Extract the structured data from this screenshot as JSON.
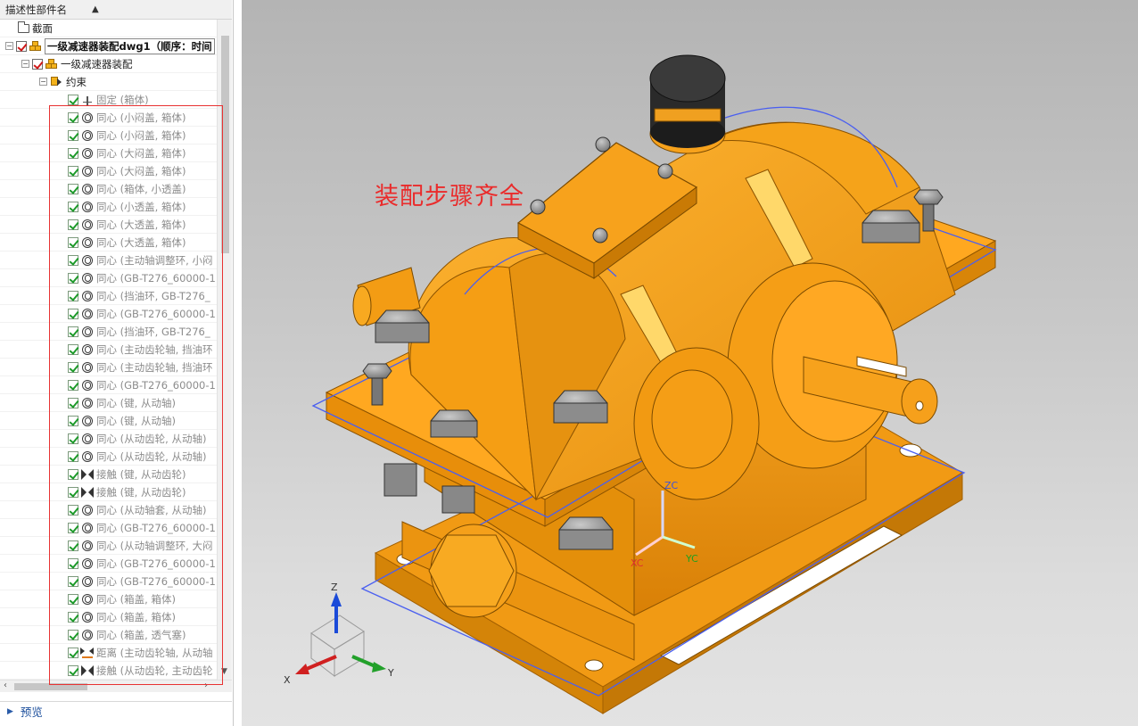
{
  "navigator": {
    "column_header": "描述性部件名",
    "sort_icon": "sort-ascending-icon",
    "rows": [
      {
        "label": "截面",
        "icon": "folder-icon",
        "checkbox": false
      },
      {
        "label": "一级减速器装配dwg1（顺序：时间",
        "icon": "assembly-icon",
        "checkbox": true
      },
      {
        "label": "一级减速器装配",
        "icon": "assembly-icon",
        "checkbox": true
      },
      {
        "label": "约束",
        "icon": "constraints-icon",
        "checkbox": false
      },
      {
        "label": "固定 (箱体)",
        "icon": "fix-icon"
      },
      {
        "label": "同心 (小闷盖, 箱体)",
        "icon": "concentric-icon"
      },
      {
        "label": "同心 (小闷盖, 箱体)",
        "icon": "concentric-icon"
      },
      {
        "label": "同心 (大闷盖, 箱体)",
        "icon": "concentric-icon"
      },
      {
        "label": "同心 (大闷盖, 箱体)",
        "icon": "concentric-icon"
      },
      {
        "label": "同心 (箱体, 小透盖)",
        "icon": "concentric-icon"
      },
      {
        "label": "同心 (小透盖, 箱体)",
        "icon": "concentric-icon"
      },
      {
        "label": "同心 (大透盖, 箱体)",
        "icon": "concentric-icon"
      },
      {
        "label": "同心 (大透盖, 箱体)",
        "icon": "concentric-icon"
      },
      {
        "label": "同心 (主动轴调整环, 小闷",
        "icon": "concentric-icon"
      },
      {
        "label": "同心 (GB-T276_60000-1",
        "icon": "concentric-icon"
      },
      {
        "label": "同心 (挡油环, GB-T276_",
        "icon": "concentric-icon"
      },
      {
        "label": "同心 (GB-T276_60000-1",
        "icon": "concentric-icon"
      },
      {
        "label": "同心 (挡油环, GB-T276_",
        "icon": "concentric-icon"
      },
      {
        "label": "同心 (主动齿轮轴, 挡油环",
        "icon": "concentric-icon"
      },
      {
        "label": "同心 (主动齿轮轴, 挡油环",
        "icon": "concentric-icon"
      },
      {
        "label": "同心 (GB-T276_60000-1",
        "icon": "concentric-icon"
      },
      {
        "label": "同心 (键, 从动轴)",
        "icon": "concentric-icon"
      },
      {
        "label": "同心 (键, 从动轴)",
        "icon": "concentric-icon"
      },
      {
        "label": "同心 (从动齿轮, 从动轴)",
        "icon": "concentric-icon"
      },
      {
        "label": "同心 (从动齿轮, 从动轴)",
        "icon": "concentric-icon"
      },
      {
        "label": "接触 (键, 从动齿轮)",
        "icon": "touch-icon"
      },
      {
        "label": "接触 (键, 从动齿轮)",
        "icon": "touch-icon"
      },
      {
        "label": "同心 (从动轴套, 从动轴)",
        "icon": "concentric-icon"
      },
      {
        "label": "同心 (GB-T276_60000-1",
        "icon": "concentric-icon"
      },
      {
        "label": "同心 (从动轴调整环, 大闷",
        "icon": "concentric-icon"
      },
      {
        "label": "同心 (GB-T276_60000-1",
        "icon": "concentric-icon"
      },
      {
        "label": "同心 (GB-T276_60000-1",
        "icon": "concentric-icon"
      },
      {
        "label": "同心 (箱盖, 箱体)",
        "icon": "concentric-icon"
      },
      {
        "label": "同心 (箱盖, 箱体)",
        "icon": "concentric-icon"
      },
      {
        "label": "同心 (箱盖, 透气塞)",
        "icon": "concentric-icon"
      },
      {
        "label": "距离 (主动齿轮轴, 从动轴",
        "icon": "distance-icon"
      },
      {
        "label": "接触 (从动齿轮, 主动齿轮",
        "icon": "touch-icon"
      }
    ]
  },
  "preview_panel": {
    "label": "预览",
    "icon": "expand-triangle-icon"
  },
  "viewport": {
    "annotation": "装配步骤齐全",
    "csys_labels": {
      "zc": "ZC",
      "xc": "XC",
      "yc": "YC"
    },
    "triad_labels": {
      "z": "Z",
      "x": "X",
      "y": "Y"
    }
  },
  "colors": {
    "part_orange": "#f5a31a",
    "annotation_red": "#ea2b2b",
    "selection_blue": "#3b52e0",
    "checkmark_green": "#1d9a2a"
  }
}
